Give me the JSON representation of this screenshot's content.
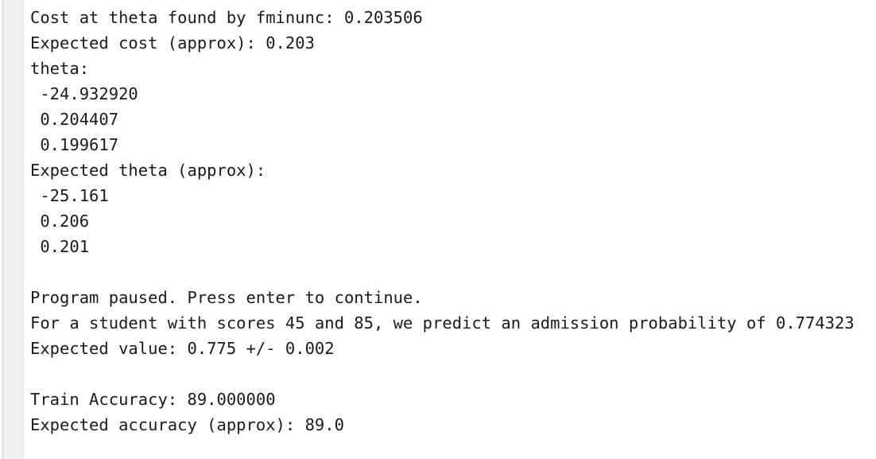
{
  "console": {
    "background_color": "#ffffff",
    "text_color": "#1b1b1b",
    "gutter_color": "#efeff0",
    "lines": [
      {
        "text": "Cost at theta found by fminunc: 0.203506",
        "blank": false
      },
      {
        "text": "Expected cost (approx): 0.203",
        "blank": false
      },
      {
        "text": "theta:",
        "blank": false
      },
      {
        "text": " -24.932920",
        "blank": false
      },
      {
        "text": " 0.204407",
        "blank": false
      },
      {
        "text": " 0.199617",
        "blank": false
      },
      {
        "text": "Expected theta (approx):",
        "blank": false
      },
      {
        "text": " -25.161",
        "blank": false
      },
      {
        "text": " 0.206",
        "blank": false
      },
      {
        "text": " 0.201",
        "blank": false
      },
      {
        "text": "",
        "blank": true
      },
      {
        "text": "Program paused. Press enter to continue.",
        "blank": false
      },
      {
        "text": "For a student with scores 45 and 85, we predict an admission probability of 0.774323",
        "blank": false
      },
      {
        "text": "Expected value: 0.775 +/- 0.002",
        "blank": false
      },
      {
        "text": "",
        "blank": true
      },
      {
        "text": "Train Accuracy: 89.000000",
        "blank": false
      },
      {
        "text": "Expected accuracy (approx): 89.0",
        "blank": false
      }
    ],
    "values": {
      "cost_at_theta": "0.203506",
      "expected_cost": "0.203",
      "theta_0": "-24.932920",
      "theta_1": "0.204407",
      "theta_2": "0.199617",
      "expected_theta_0": "-25.161",
      "expected_theta_1": "0.206",
      "expected_theta_2": "0.201",
      "student_score_1": "45",
      "student_score_2": "85",
      "admission_probability": "0.774323",
      "expected_value": "0.775",
      "expected_value_tolerance": "0.002",
      "train_accuracy": "89.000000",
      "expected_accuracy": "89.0"
    }
  }
}
